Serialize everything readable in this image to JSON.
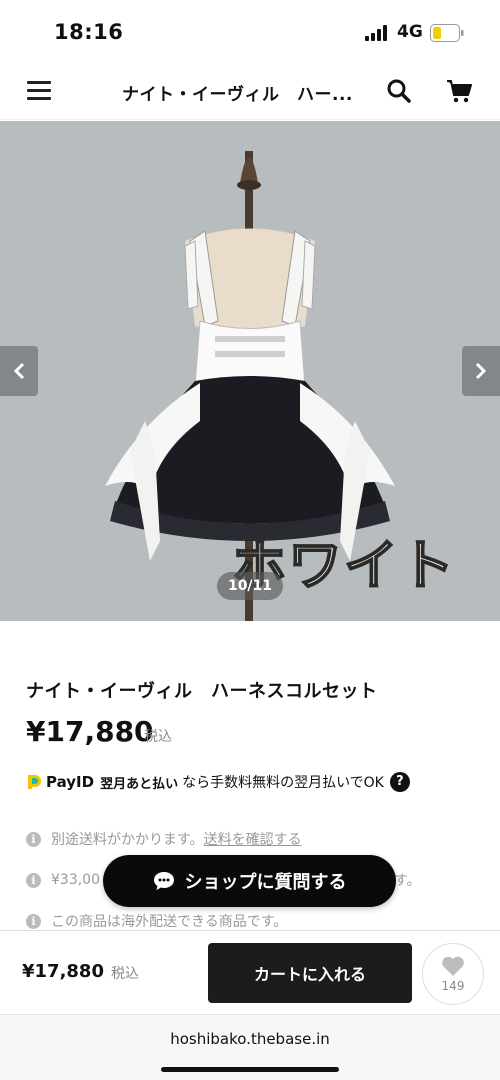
{
  "status": {
    "time": "18:16",
    "network": "4G"
  },
  "header": {
    "title": "ナイト・イーヴィル　ハー..."
  },
  "gallery": {
    "counter": "10/11",
    "variant_label": "ホワイト"
  },
  "product": {
    "name": "ナイト・イーヴィル　ハーネスコルセット",
    "price": "¥17,880",
    "tax": "税込"
  },
  "payid": {
    "name": "PayID",
    "later": "翌月あと払い",
    "text": "なら手数料無料の翌月払いでOK",
    "help": "?"
  },
  "info": {
    "icon": "i",
    "line1_text": "別途送料がかかります。",
    "line1_link": "送料を確認する",
    "line2_left": "¥33,00",
    "line2_right": "す。",
    "line3": "この商品は海外配送できる商品です。"
  },
  "ask_button": {
    "label": "ショップに質問する"
  },
  "bottom_bar": {
    "price": "¥17,880",
    "tax": "税込",
    "add_to_cart": "カートに入れる",
    "favorite_count": "149"
  },
  "browser": {
    "url": "hoshibako.thebase.in"
  },
  "colors": {
    "payid_accent": "#f5c400",
    "payid_teal": "#1fb5a8",
    "gallery_bg": "#b7bdbf"
  }
}
